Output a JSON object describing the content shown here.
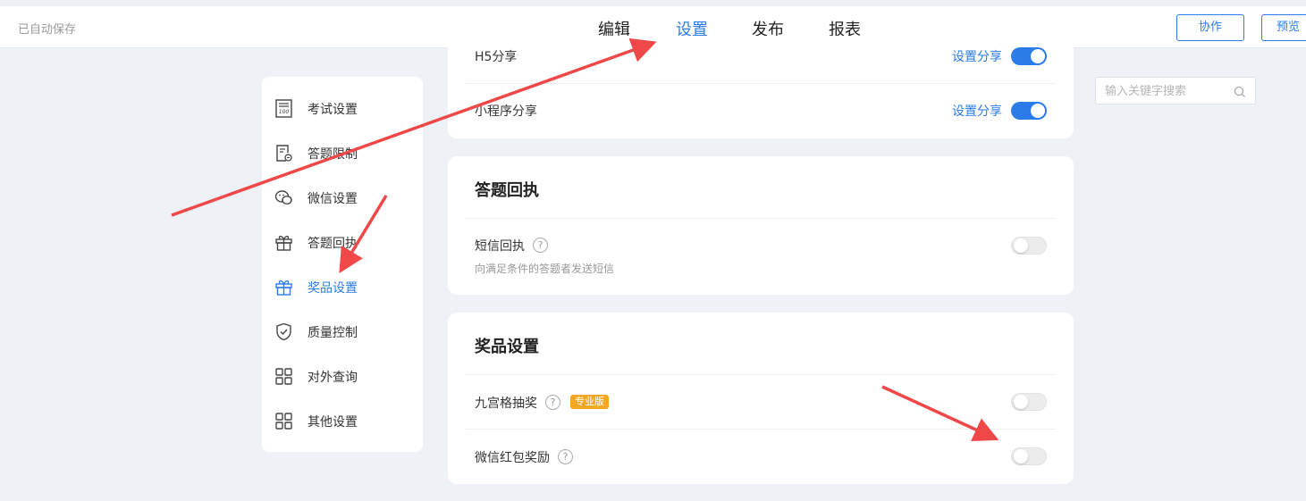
{
  "header": {
    "autosave": "已自动保存",
    "tabs": [
      {
        "label": "编辑",
        "active": false
      },
      {
        "label": "设置",
        "active": true
      },
      {
        "label": "发布",
        "active": false
      },
      {
        "label": "报表",
        "active": false
      }
    ],
    "collab_label": "协作",
    "preview_label": "预览"
  },
  "sidebar": {
    "items": [
      {
        "label": "考试设置",
        "icon": "exam-sheet-icon"
      },
      {
        "label": "答题限制",
        "icon": "doc-limit-icon"
      },
      {
        "label": "微信设置",
        "icon": "wechat-icon"
      },
      {
        "label": "答题回执",
        "icon": "gift-icon"
      },
      {
        "label": "奖品设置",
        "icon": "gift-icon",
        "active": true
      },
      {
        "label": "质量控制",
        "icon": "shield-check-icon"
      },
      {
        "label": "对外查询",
        "icon": "grid-icon"
      },
      {
        "label": "其他设置",
        "icon": "grid-icon"
      }
    ]
  },
  "share_card": {
    "rows": [
      {
        "label": "H5分享",
        "link": "设置分享",
        "enabled": true
      },
      {
        "label": "小程序分享",
        "link": "设置分享",
        "enabled": true
      }
    ]
  },
  "receipt_card": {
    "title": "答题回执",
    "sms_label": "短信回执",
    "sms_desc": "向满足条件的答题者发送短信",
    "help_glyph": "?",
    "sms_enabled": false
  },
  "prize_card": {
    "title": "奖品设置",
    "lottery_label": "九宫格抽奖",
    "pro_badge": "专业版",
    "lottery_enabled": false,
    "redpacket_label": "微信红包奖励",
    "redpacket_enabled": false
  },
  "search": {
    "placeholder": "输入关键字搜索"
  },
  "colors": {
    "accent": "#2b7ce9",
    "arrow": "#f04848",
    "badge": "#f5a623"
  }
}
